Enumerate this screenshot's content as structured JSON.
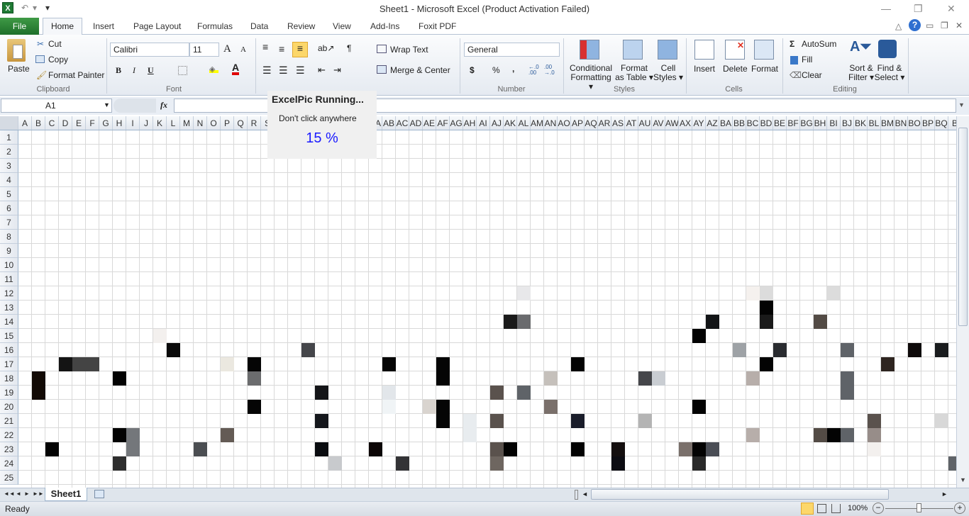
{
  "window": {
    "title": "Sheet1 - Microsoft Excel (Product Activation Failed)",
    "app_icon": "X",
    "minimize": "—",
    "restore": "❐",
    "close": "✕"
  },
  "quick_access": {
    "undo": "↶",
    "undo_dropdown": "▾",
    "customize": "▾"
  },
  "tabs": [
    "File",
    "Home",
    "Insert",
    "Page Layout",
    "Formulas",
    "Data",
    "Review",
    "View",
    "Add-Ins",
    "Foxit PDF"
  ],
  "ribbon_right_icons": {
    "collapse": "△",
    "help": "?",
    "min": "▭",
    "restore": "❐",
    "close": "✕"
  },
  "ribbon": {
    "clipboard": {
      "label": "Clipboard",
      "paste": "Paste",
      "cut": "Cut",
      "copy": "Copy",
      "format_painter": "Format Painter"
    },
    "font": {
      "label": "Font",
      "font_name": "Calibri",
      "font_size": "11",
      "bold": "B",
      "italic": "I",
      "underline": "U",
      "grow": "A",
      "shrink": "A",
      "font_color": "A",
      "fill_color_hex": "#ffff00",
      "font_color_hex": "#e00000"
    },
    "alignment": {
      "wrap_text": "Wrap Text",
      "merge_center": "Merge & Center"
    },
    "number": {
      "label": "Number",
      "format": "General",
      "currency": "$",
      "percent": "%",
      "comma": ",",
      "inc_decimal": "←.0 .00",
      "dec_decimal": ".00 →.0"
    },
    "styles": {
      "label": "Styles",
      "conditional": [
        "Conditional",
        "Formatting ▾"
      ],
      "format_table": [
        "Format",
        "as Table ▾"
      ],
      "cell_styles": [
        "Cell",
        "Styles ▾"
      ]
    },
    "cells": {
      "label": "Cells",
      "insert": "Insert",
      "delete": "Delete",
      "format": "Format"
    },
    "editing": {
      "label": "Editing",
      "autosum": "AutoSum",
      "fill": "Fill",
      "clear": "Clear",
      "sort": [
        "Sort &",
        "Filter ▾"
      ],
      "find": [
        "Find &",
        "Select ▾"
      ]
    }
  },
  "formula_bar": {
    "name_box": "A1",
    "fx": "fx",
    "value": ""
  },
  "columns": [
    "A",
    "B",
    "C",
    "D",
    "E",
    "F",
    "G",
    "H",
    "I",
    "J",
    "K",
    "L",
    "M",
    "N",
    "O",
    "P",
    "Q",
    "R",
    "S",
    "T",
    "U",
    "V",
    "W",
    "X",
    "Y",
    "Z",
    "AA",
    "AB",
    "AC",
    "AD",
    "AE",
    "AF",
    "AG",
    "AH",
    "AI",
    "AJ",
    "AK",
    "AL",
    "AM",
    "AN",
    "AO",
    "AP",
    "AQ",
    "AR",
    "AS",
    "AT",
    "AU",
    "AV",
    "AW",
    "AX",
    "AY",
    "AZ",
    "BA",
    "BB",
    "BC",
    "BD",
    "BE",
    "BF",
    "BG",
    "BH",
    "BI",
    "BJ",
    "BK",
    "BL",
    "BM",
    "BN",
    "BO",
    "BP",
    "BQ",
    "B"
  ],
  "rows": [
    "1",
    "2",
    "3",
    "4",
    "5",
    "6",
    "7",
    "8",
    "9",
    "10",
    "11",
    "12",
    "13",
    "14",
    "15",
    "16",
    "17",
    "18",
    "19",
    "20",
    "21",
    "22",
    "23",
    "24",
    "25"
  ],
  "filled_cells": [
    {
      "col": 10,
      "row": 15,
      "color": "#f3f0ee"
    },
    {
      "col": 11,
      "row": 16,
      "color": "#0a0a0a"
    },
    {
      "col": 21,
      "row": 16,
      "color": "#45464a"
    },
    {
      "col": 3,
      "row": 17,
      "color": "#141414"
    },
    {
      "col": 4,
      "row": 17,
      "color": "#444444"
    },
    {
      "col": 5,
      "row": 17,
      "color": "#444444"
    },
    {
      "col": 15,
      "row": 17,
      "color": "#ebe8e0"
    },
    {
      "col": 17,
      "row": 17,
      "color": "#050505"
    },
    {
      "col": 27,
      "row": 17,
      "color": "#050505"
    },
    {
      "col": 31,
      "row": 17,
      "color": "#050505"
    },
    {
      "col": 1,
      "row": 18,
      "color": "#120a05"
    },
    {
      "col": 7,
      "row": 18,
      "color": "#030303"
    },
    {
      "col": 17,
      "row": 18,
      "color": "#6b6c6e"
    },
    {
      "col": 31,
      "row": 18,
      "color": "#050505"
    },
    {
      "col": 1,
      "row": 19,
      "color": "#120a05"
    },
    {
      "col": 22,
      "row": 19,
      "color": "#141518"
    },
    {
      "col": 27,
      "row": 19,
      "color": "#e2e6ea"
    },
    {
      "col": 17,
      "row": 20,
      "color": "#050505"
    },
    {
      "col": 27,
      "row": 20,
      "color": "#f0f4f6"
    },
    {
      "col": 30,
      "row": 20,
      "color": "#d9d4cf"
    },
    {
      "col": 31,
      "row": 20,
      "color": "#050505"
    },
    {
      "col": 22,
      "row": 21,
      "color": "#15171c"
    },
    {
      "col": 31,
      "row": 21,
      "color": "#050505"
    },
    {
      "col": 33,
      "row": 21,
      "color": "#e8ecef"
    },
    {
      "col": 7,
      "row": 22,
      "color": "#030303"
    },
    {
      "col": 8,
      "row": 22,
      "color": "#74777b"
    },
    {
      "col": 15,
      "row": 22,
      "color": "#645b55"
    },
    {
      "col": 33,
      "row": 22,
      "color": "#e8ecef"
    },
    {
      "col": 2,
      "row": 23,
      "color": "#030303"
    },
    {
      "col": 8,
      "row": 23,
      "color": "#74777b"
    },
    {
      "col": 13,
      "row": 23,
      "color": "#4b4e52"
    },
    {
      "col": 22,
      "row": 23,
      "color": "#0a0c10"
    },
    {
      "col": 26,
      "row": 23,
      "color": "#0c0606"
    },
    {
      "col": 7,
      "row": 24,
      "color": "#2e2e2e"
    },
    {
      "col": 23,
      "row": 24,
      "color": "#c8cacd"
    },
    {
      "col": 28,
      "row": 24,
      "color": "#333336"
    },
    {
      "col": 37,
      "row": 12,
      "color": "#e8e8ea"
    },
    {
      "col": 54,
      "row": 12,
      "color": "#f5f1ee"
    },
    {
      "col": 55,
      "row": 12,
      "color": "#dcdcdc"
    },
    {
      "col": 60,
      "row": 12,
      "color": "#dcdcdc"
    },
    {
      "col": 55,
      "row": 13,
      "color": "#030303"
    },
    {
      "col": 36,
      "row": 14,
      "color": "#1a1a1a"
    },
    {
      "col": 37,
      "row": 14,
      "color": "#6a6b6e"
    },
    {
      "col": 51,
      "row": 14,
      "color": "#121416"
    },
    {
      "col": 55,
      "row": 14,
      "color": "#1a1a1a"
    },
    {
      "col": 59,
      "row": 14,
      "color": "#534b45"
    },
    {
      "col": 50,
      "row": 15,
      "color": "#030303"
    },
    {
      "col": 53,
      "row": 16,
      "color": "#9ea2a6"
    },
    {
      "col": 56,
      "row": 16,
      "color": "#2a2c30"
    },
    {
      "col": 61,
      "row": 16,
      "color": "#5f6368"
    },
    {
      "col": 66,
      "row": 16,
      "color": "#0e0a0a"
    },
    {
      "col": 68,
      "row": 16,
      "color": "#1a1c1e"
    },
    {
      "col": 41,
      "row": 17,
      "color": "#030303"
    },
    {
      "col": 55,
      "row": 17,
      "color": "#030303"
    },
    {
      "col": 64,
      "row": 17,
      "color": "#2e2520"
    },
    {
      "col": 39,
      "row": 18,
      "color": "#c5c0bb"
    },
    {
      "col": 46,
      "row": 18,
      "color": "#45464a"
    },
    {
      "col": 47,
      "row": 18,
      "color": "#c9cdd2"
    },
    {
      "col": 54,
      "row": 18,
      "color": "#b7aeaa"
    },
    {
      "col": 61,
      "row": 18,
      "color": "#5f6368"
    },
    {
      "col": 35,
      "row": 19,
      "color": "#5a524d"
    },
    {
      "col": 37,
      "row": 19,
      "color": "#5f6368"
    },
    {
      "col": 61,
      "row": 19,
      "color": "#5f6368"
    },
    {
      "col": 39,
      "row": 20,
      "color": "#7a706b"
    },
    {
      "col": 50,
      "row": 20,
      "color": "#030303"
    },
    {
      "col": 35,
      "row": 21,
      "color": "#5a524d"
    },
    {
      "col": 41,
      "row": 21,
      "color": "#1a1d2a"
    },
    {
      "col": 46,
      "row": 21,
      "color": "#b4b4b4"
    },
    {
      "col": 63,
      "row": 21,
      "color": "#5a524d"
    },
    {
      "col": 68,
      "row": 21,
      "color": "#d8d8d8"
    },
    {
      "col": 54,
      "row": 22,
      "color": "#b7aeaa"
    },
    {
      "col": 59,
      "row": 22,
      "color": "#534b45"
    },
    {
      "col": 60,
      "row": 22,
      "color": "#030303"
    },
    {
      "col": 61,
      "row": 22,
      "color": "#5f6368"
    },
    {
      "col": 63,
      "row": 22,
      "color": "#978d89"
    },
    {
      "col": 35,
      "row": 23,
      "color": "#5a524d"
    },
    {
      "col": 36,
      "row": 23,
      "color": "#030303"
    },
    {
      "col": 41,
      "row": 23,
      "color": "#030303"
    },
    {
      "col": 44,
      "row": 23,
      "color": "#140f0f"
    },
    {
      "col": 49,
      "row": 23,
      "color": "#7a706b"
    },
    {
      "col": 50,
      "row": 23,
      "color": "#030303"
    },
    {
      "col": 51,
      "row": 23,
      "color": "#4a4d55"
    },
    {
      "col": 63,
      "row": 23,
      "color": "#f3f0ee"
    },
    {
      "col": 35,
      "row": 24,
      "color": "#6e6660"
    },
    {
      "col": 44,
      "row": 24,
      "color": "#0c0c12"
    },
    {
      "col": 50,
      "row": 24,
      "color": "#2a2a2a"
    },
    {
      "col": 69,
      "row": 24,
      "color": "#5f6368"
    }
  ],
  "popup": {
    "title": "ExcelPic Running...",
    "message": "Don't click anywhere",
    "progress": "15 %",
    "progress_color": "#1a1aff"
  },
  "sheet_tabs": {
    "nav": [
      "◄◄",
      "◄",
      "►",
      "►►"
    ],
    "active": "Sheet1"
  },
  "status": {
    "ready": "Ready",
    "zoom": "100%",
    "zoom_out": "−",
    "zoom_in": "+",
    "zoom_level": 1.0
  }
}
